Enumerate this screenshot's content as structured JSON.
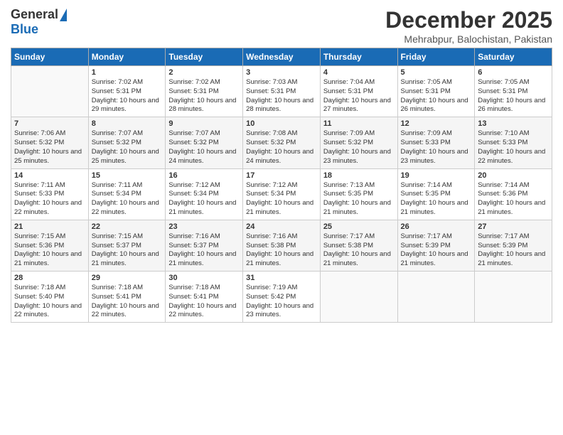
{
  "logo": {
    "general": "General",
    "blue": "Blue"
  },
  "title": "December 2025",
  "location": "Mehrabpur, Balochistan, Pakistan",
  "days_of_week": [
    "Sunday",
    "Monday",
    "Tuesday",
    "Wednesday",
    "Thursday",
    "Friday",
    "Saturday"
  ],
  "weeks": [
    [
      {
        "day": "",
        "info": ""
      },
      {
        "day": "1",
        "info": "Sunrise: 7:02 AM\nSunset: 5:31 PM\nDaylight: 10 hours\nand 29 minutes."
      },
      {
        "day": "2",
        "info": "Sunrise: 7:02 AM\nSunset: 5:31 PM\nDaylight: 10 hours\nand 28 minutes."
      },
      {
        "day": "3",
        "info": "Sunrise: 7:03 AM\nSunset: 5:31 PM\nDaylight: 10 hours\nand 28 minutes."
      },
      {
        "day": "4",
        "info": "Sunrise: 7:04 AM\nSunset: 5:31 PM\nDaylight: 10 hours\nand 27 minutes."
      },
      {
        "day": "5",
        "info": "Sunrise: 7:05 AM\nSunset: 5:31 PM\nDaylight: 10 hours\nand 26 minutes."
      },
      {
        "day": "6",
        "info": "Sunrise: 7:05 AM\nSunset: 5:31 PM\nDaylight: 10 hours\nand 26 minutes."
      }
    ],
    [
      {
        "day": "7",
        "info": "Sunrise: 7:06 AM\nSunset: 5:32 PM\nDaylight: 10 hours\nand 25 minutes."
      },
      {
        "day": "8",
        "info": "Sunrise: 7:07 AM\nSunset: 5:32 PM\nDaylight: 10 hours\nand 25 minutes."
      },
      {
        "day": "9",
        "info": "Sunrise: 7:07 AM\nSunset: 5:32 PM\nDaylight: 10 hours\nand 24 minutes."
      },
      {
        "day": "10",
        "info": "Sunrise: 7:08 AM\nSunset: 5:32 PM\nDaylight: 10 hours\nand 24 minutes."
      },
      {
        "day": "11",
        "info": "Sunrise: 7:09 AM\nSunset: 5:32 PM\nDaylight: 10 hours\nand 23 minutes."
      },
      {
        "day": "12",
        "info": "Sunrise: 7:09 AM\nSunset: 5:33 PM\nDaylight: 10 hours\nand 23 minutes."
      },
      {
        "day": "13",
        "info": "Sunrise: 7:10 AM\nSunset: 5:33 PM\nDaylight: 10 hours\nand 22 minutes."
      }
    ],
    [
      {
        "day": "14",
        "info": "Sunrise: 7:11 AM\nSunset: 5:33 PM\nDaylight: 10 hours\nand 22 minutes."
      },
      {
        "day": "15",
        "info": "Sunrise: 7:11 AM\nSunset: 5:34 PM\nDaylight: 10 hours\nand 22 minutes."
      },
      {
        "day": "16",
        "info": "Sunrise: 7:12 AM\nSunset: 5:34 PM\nDaylight: 10 hours\nand 21 minutes."
      },
      {
        "day": "17",
        "info": "Sunrise: 7:12 AM\nSunset: 5:34 PM\nDaylight: 10 hours\nand 21 minutes."
      },
      {
        "day": "18",
        "info": "Sunrise: 7:13 AM\nSunset: 5:35 PM\nDaylight: 10 hours\nand 21 minutes."
      },
      {
        "day": "19",
        "info": "Sunrise: 7:14 AM\nSunset: 5:35 PM\nDaylight: 10 hours\nand 21 minutes."
      },
      {
        "day": "20",
        "info": "Sunrise: 7:14 AM\nSunset: 5:36 PM\nDaylight: 10 hours\nand 21 minutes."
      }
    ],
    [
      {
        "day": "21",
        "info": "Sunrise: 7:15 AM\nSunset: 5:36 PM\nDaylight: 10 hours\nand 21 minutes."
      },
      {
        "day": "22",
        "info": "Sunrise: 7:15 AM\nSunset: 5:37 PM\nDaylight: 10 hours\nand 21 minutes."
      },
      {
        "day": "23",
        "info": "Sunrise: 7:16 AM\nSunset: 5:37 PM\nDaylight: 10 hours\nand 21 minutes."
      },
      {
        "day": "24",
        "info": "Sunrise: 7:16 AM\nSunset: 5:38 PM\nDaylight: 10 hours\nand 21 minutes."
      },
      {
        "day": "25",
        "info": "Sunrise: 7:17 AM\nSunset: 5:38 PM\nDaylight: 10 hours\nand 21 minutes."
      },
      {
        "day": "26",
        "info": "Sunrise: 7:17 AM\nSunset: 5:39 PM\nDaylight: 10 hours\nand 21 minutes."
      },
      {
        "day": "27",
        "info": "Sunrise: 7:17 AM\nSunset: 5:39 PM\nDaylight: 10 hours\nand 21 minutes."
      }
    ],
    [
      {
        "day": "28",
        "info": "Sunrise: 7:18 AM\nSunset: 5:40 PM\nDaylight: 10 hours\nand 22 minutes."
      },
      {
        "day": "29",
        "info": "Sunrise: 7:18 AM\nSunset: 5:41 PM\nDaylight: 10 hours\nand 22 minutes."
      },
      {
        "day": "30",
        "info": "Sunrise: 7:18 AM\nSunset: 5:41 PM\nDaylight: 10 hours\nand 22 minutes."
      },
      {
        "day": "31",
        "info": "Sunrise: 7:19 AM\nSunset: 5:42 PM\nDaylight: 10 hours\nand 23 minutes."
      },
      {
        "day": "",
        "info": ""
      },
      {
        "day": "",
        "info": ""
      },
      {
        "day": "",
        "info": ""
      }
    ]
  ]
}
